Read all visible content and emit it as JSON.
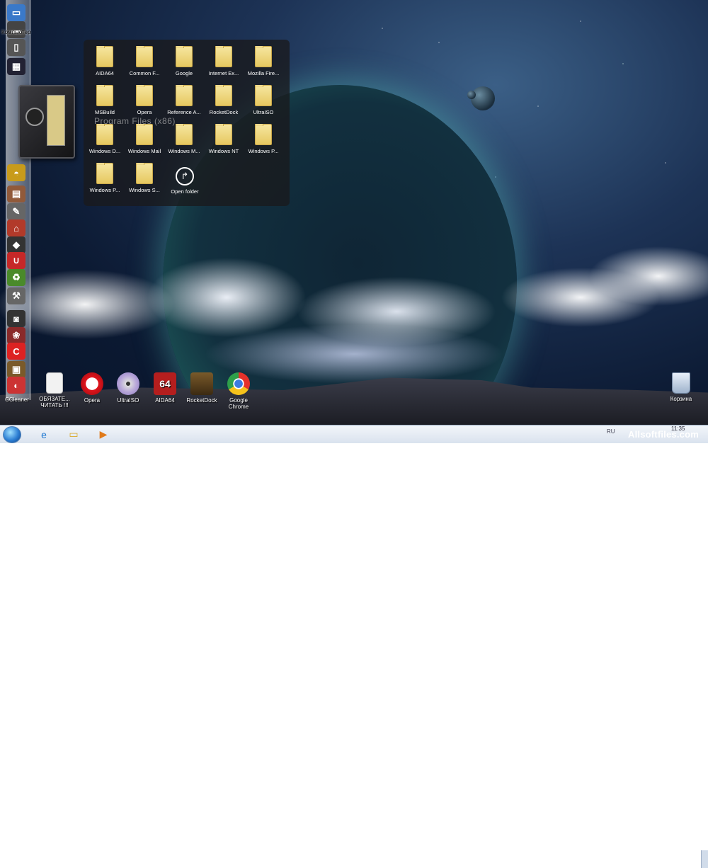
{
  "dock": {
    "top_label": "Компьютер",
    "bottom_label": "CCleaner",
    "items": [
      {
        "name": "computer-icon",
        "glyph": "▭",
        "color": "#3a79c9"
      },
      {
        "name": "monitor-icon",
        "glyph": "▬",
        "color": "#444"
      },
      {
        "name": "phone-icon",
        "glyph": "▯",
        "color": "#555"
      },
      {
        "name": "media-icon",
        "glyph": "▦",
        "color": "#223"
      },
      {
        "name": "helmet-icon",
        "glyph": "◓",
        "color": "#c89b1b"
      },
      {
        "name": "gallery-icon",
        "glyph": "▤",
        "color": "#915a3a"
      },
      {
        "name": "tools-icon",
        "glyph": "✎",
        "color": "#666"
      },
      {
        "name": "house-icon",
        "glyph": "⌂",
        "color": "#b23a2a"
      },
      {
        "name": "box-icon",
        "glyph": "◆",
        "color": "#333"
      },
      {
        "name": "magnet-icon",
        "glyph": "∪",
        "color": "#c62828"
      },
      {
        "name": "recycle-icon",
        "glyph": "♻",
        "color": "#4a8a2a"
      },
      {
        "name": "wrench-icon",
        "glyph": "⚒",
        "color": "#666"
      },
      {
        "name": "camera-icon",
        "glyph": "◙",
        "color": "#333"
      },
      {
        "name": "garden-icon",
        "glyph": "❀",
        "color": "#8a2a2a"
      },
      {
        "name": "ccleaner-icon",
        "glyph": "C",
        "color": "#d22"
      },
      {
        "name": "chest-icon",
        "glyph": "▣",
        "color": "#7a5a2a"
      },
      {
        "name": "ccleaner-app-icon",
        "glyph": "◐",
        "color": "#c33"
      }
    ]
  },
  "stack": {
    "title": "Program Files (x86)",
    "items": [
      {
        "label": "AIDA64"
      },
      {
        "label": "Common F..."
      },
      {
        "label": "Google"
      },
      {
        "label": "Internet Ex..."
      },
      {
        "label": "Mozilla Fire..."
      },
      {
        "label": "MSBuild"
      },
      {
        "label": "Opera"
      },
      {
        "label": "Reference A..."
      },
      {
        "label": "RocketDock"
      },
      {
        "label": "UltraISO"
      },
      {
        "label": "Windows D..."
      },
      {
        "label": "Windows Mail"
      },
      {
        "label": "Windows M..."
      },
      {
        "label": "Windows NT"
      },
      {
        "label": "Windows P..."
      },
      {
        "label": "Windows P..."
      },
      {
        "label": "Windows S..."
      }
    ],
    "open_label": "Open folder"
  },
  "shortcuts": [
    {
      "label": "ОБЯЗАТЕ...\nЧИТАТЬ !!!",
      "icon": "document-icon"
    },
    {
      "label": "Opera",
      "icon": "opera-icon"
    },
    {
      "label": "UltraISO",
      "icon": "ultraiso-icon"
    },
    {
      "label": "AIDA64",
      "icon": "aida64-icon",
      "badge": "64"
    },
    {
      "label": "RocketDock",
      "icon": "rocketdock-icon"
    },
    {
      "label": "Google\nChrome",
      "icon": "chrome-icon"
    }
  ],
  "recycle_bin": {
    "label": "Корзина"
  },
  "taskbar": {
    "pinned": [
      {
        "name": "internet-explorer-icon",
        "glyph": "e"
      },
      {
        "name": "explorer-icon",
        "glyph": "▭"
      },
      {
        "name": "media-player-icon",
        "glyph": "▶"
      }
    ],
    "language": "RU",
    "clock": "11:35"
  },
  "watermark": "Allsoftfiles.com"
}
